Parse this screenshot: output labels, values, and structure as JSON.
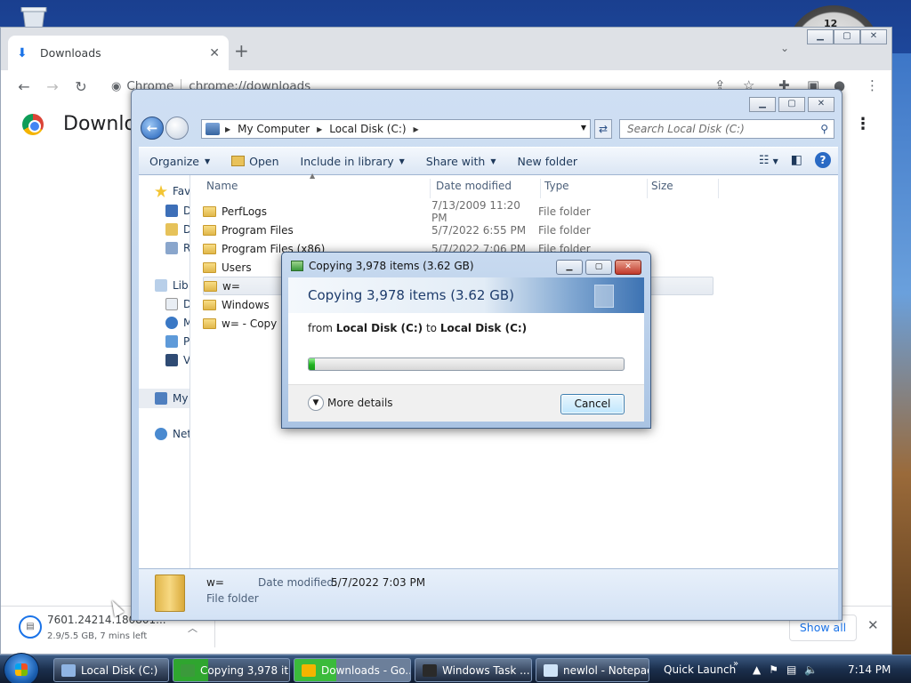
{
  "chrome": {
    "tab_title": "Downloads",
    "new_tab": "+",
    "omnibox_label": "Chrome",
    "url": "chrome://downloads",
    "page_title": "Downlo",
    "download": {
      "name": "7601.24214.180801...",
      "status": "2.9/5.5 GB, 7 mins left"
    },
    "show_all": "Show all"
  },
  "explorer": {
    "breadcrumb": [
      "My Computer",
      "Local Disk (C:)"
    ],
    "search_placeholder": "Search Local Disk (C:)",
    "commands": [
      "Organize",
      "Open",
      "Include in library",
      "Share with",
      "New folder"
    ],
    "nav_pane": [
      "Fav",
      "D",
      "D",
      "R",
      "Lib",
      "D",
      "M",
      "P",
      "V",
      "My",
      "Net"
    ],
    "columns": [
      "Name",
      "Date modified",
      "Type",
      "Size"
    ],
    "files": [
      {
        "name": "PerfLogs",
        "date": "7/13/2009 11:20 PM",
        "type": "File folder"
      },
      {
        "name": "Program Files",
        "date": "5/7/2022 6:55 PM",
        "type": "File folder"
      },
      {
        "name": "Program Files (x86)",
        "date": "5/7/2022 7:06 PM",
        "type": "File folder"
      },
      {
        "name": "Users",
        "date": "",
        "type": ""
      },
      {
        "name": "w=",
        "date": "",
        "type": ""
      },
      {
        "name": "Windows",
        "date": "",
        "type": ""
      },
      {
        "name": "w= - Copy",
        "date": "",
        "type": ""
      }
    ],
    "details": {
      "name": "w=",
      "type": "File folder",
      "modified_label": "Date modified:",
      "modified_value": "5/7/2022 7:03 PM"
    }
  },
  "copy_dialog": {
    "title": "Copying 3,978 items (3.62 GB)",
    "heading": "Copying 3,978 items (3.62 GB)",
    "from_prefix": "from",
    "from_source": "Local Disk (C:)",
    "from_to": "to",
    "from_dest": "Local Disk (C:)",
    "progress_fraction": 0.02,
    "more_details": "More details",
    "cancel": "Cancel"
  },
  "taskbar": {
    "tasks": [
      {
        "label": "Local Disk (C:)",
        "icon_color": "#8fb4e3"
      },
      {
        "label": "Copying 3,978 it...",
        "icon_color": "#3b9a3b"
      },
      {
        "label": "Downloads - Go...",
        "icon_color": "#f4b400"
      },
      {
        "label": "Windows Task ...",
        "icon_color": "#2a2a2a"
      },
      {
        "label": "newlol - Notepad",
        "icon_color": "#cfe3f7"
      }
    ],
    "quick_launch": "Quick Launch",
    "time": "7:14 PM"
  }
}
